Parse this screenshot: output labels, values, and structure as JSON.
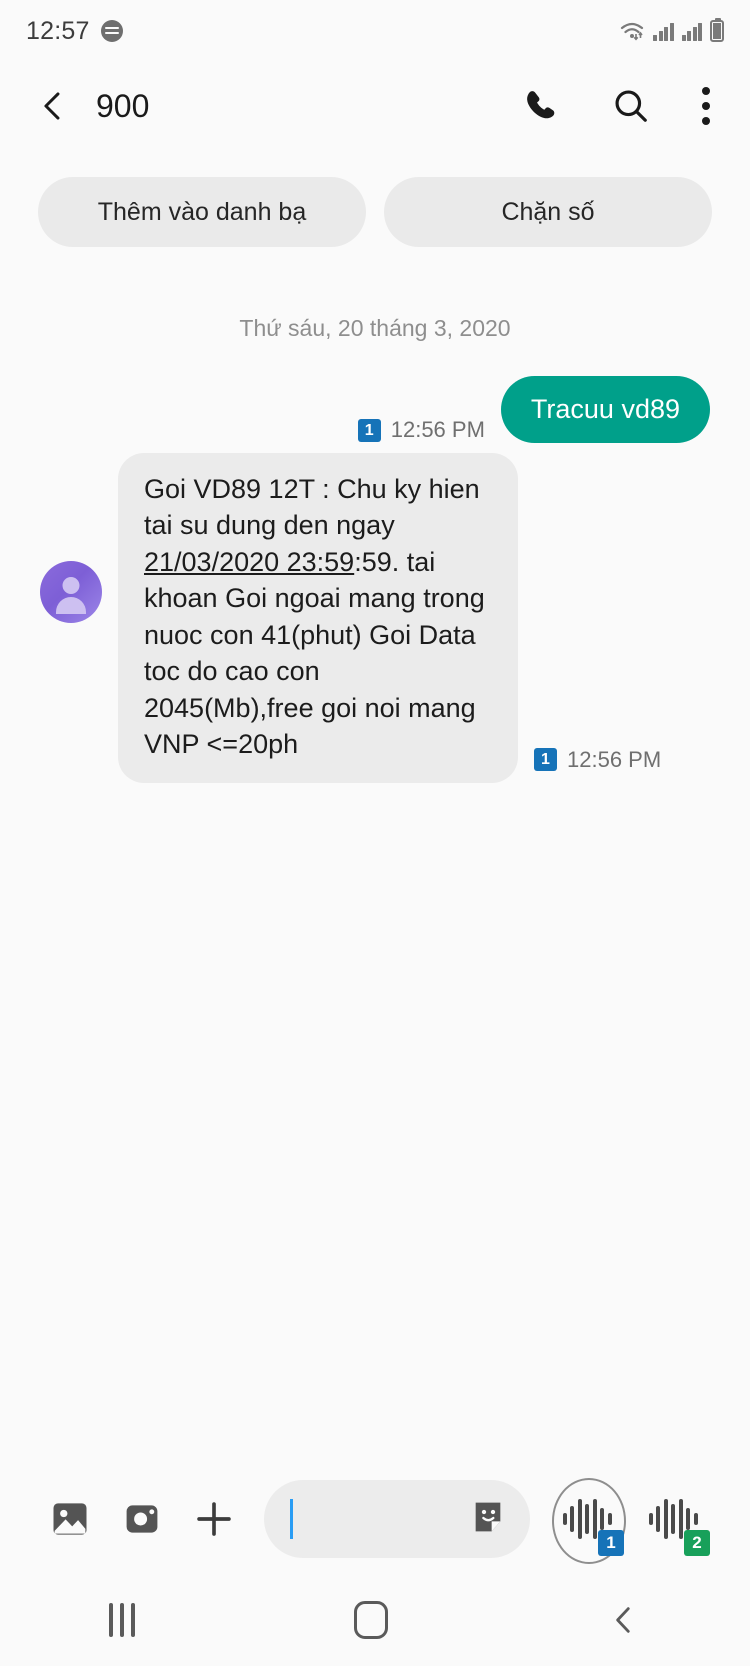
{
  "statusbar": {
    "clock": "12:57",
    "icons": [
      "spotify-icon",
      "wifi-icon",
      "signal-1-icon",
      "signal-2-icon",
      "battery-icon"
    ]
  },
  "appbar": {
    "back_icon": "back-arrow-icon",
    "title": "900",
    "call_icon": "phone-icon",
    "search_icon": "search-icon",
    "overflow_icon": "more-options-icon"
  },
  "chips": [
    {
      "label": "Thêm vào danh bạ"
    },
    {
      "label": "Chặn số"
    }
  ],
  "conversation": {
    "date_separator": "Thứ sáu, 20 tháng 3, 2020",
    "messages": [
      {
        "direction": "outgoing",
        "text": "Tracuu vd89",
        "time": "12:56 PM",
        "sim": "1"
      },
      {
        "direction": "incoming",
        "text_before_link": "Goi VD89 12T : Chu ky hien tai su dung den ngay ",
        "link_text": "21/03/2020 23:59",
        "text_after_link": ":59. tai khoan Goi ngoai mang trong nuoc con 41(phut) Goi Data toc do cao con 2045(Mb),free goi noi mang VNP <=20ph",
        "time": "12:56 PM",
        "sim": "1"
      }
    ]
  },
  "toolbar": {
    "gallery_icon": "image-icon",
    "camera_icon": "camera-icon",
    "add_icon": "plus-icon",
    "input_value": "",
    "input_placeholder": "",
    "sticker_icon": "sticker-icon",
    "send_sim1_icon": "voice-send-icon",
    "send_sim1_badge": "1",
    "send_sim2_icon": "voice-send-icon",
    "send_sim2_badge": "2"
  },
  "navbar": {
    "recents_icon": "recents-icon",
    "home_icon": "home-icon",
    "back_icon": "nav-back-icon"
  },
  "colors": {
    "accent_green": "#00a08a",
    "sim1_blue": "#1673b8",
    "sim2_green": "#18a05a",
    "bubble_in": "#ebebeb",
    "chip_bg": "#eaeaea",
    "caret_blue": "#2a9df4"
  }
}
